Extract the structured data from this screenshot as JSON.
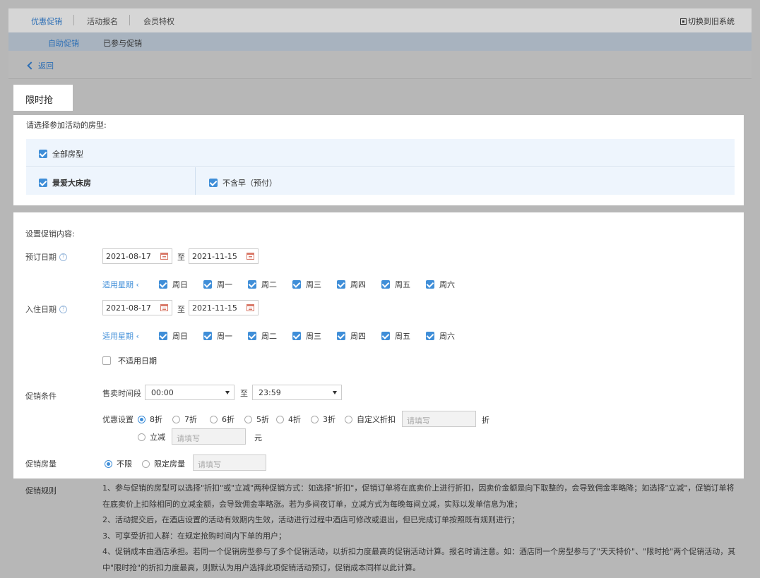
{
  "topnav": {
    "tabs": [
      {
        "label": "优惠促销",
        "active": true
      },
      {
        "label": "活动报名",
        "active": false
      },
      {
        "label": "会员特权",
        "active": false
      }
    ],
    "switch_label": "切换到旧系统"
  },
  "subnav": {
    "tabs": [
      {
        "label": "自助促销",
        "active": true
      },
      {
        "label": "已参与促销",
        "active": false
      }
    ]
  },
  "back_label": "返回",
  "page_title": "限时抢",
  "rooms": {
    "prompt": "请选择参加活动的房型:",
    "all_label": "全部房型",
    "room_name": "景爱大床房",
    "rate_plan": "不含早（预付）"
  },
  "promo": {
    "section_title": "设置促销内容:",
    "booking_date": {
      "label": "预订日期",
      "start": "2021-08-17",
      "separator": "至",
      "end": "2021-11-15",
      "week_link": "适用星期",
      "weekdays": [
        "周日",
        "周一",
        "周二",
        "周三",
        "周四",
        "周五",
        "周六"
      ]
    },
    "checkin_date": {
      "label": "入住日期",
      "start": "2021-08-17",
      "separator": "至",
      "end": "2021-11-15",
      "week_link": "适用星期",
      "weekdays": [
        "周日",
        "周一",
        "周二",
        "周三",
        "周四",
        "周五",
        "周六"
      ],
      "exclude_label": "不适用日期"
    },
    "condition": {
      "label": "促销条件",
      "sale_time_label": "售卖时间段",
      "time_start": "00:00",
      "time_separator": "至",
      "time_end": "23:59",
      "discount_label": "优惠设置",
      "discount_options": [
        "8折",
        "7折",
        "6折",
        "5折",
        "4折",
        "3折",
        "自定义折扣"
      ],
      "selected_discount": "8折",
      "custom_placeholder": "请填写",
      "custom_unit": "折",
      "reduce_label": "立减",
      "reduce_placeholder": "请填写",
      "reduce_unit": "元"
    },
    "rooms_limit": {
      "label": "促销房量",
      "options": [
        "不限",
        "限定房量"
      ],
      "selected": "不限",
      "placeholder": "请填写"
    }
  },
  "rules": {
    "label": "促销规则",
    "lines": [
      "1、参与促销的房型可以选择\"折扣\"或\"立减\"两种促销方式：如选择\"折扣\"，促销订单将在底卖价上进行折扣，因卖价金额是向下取整的，会导致佣金率略降；如选择\"立减\"，促销订单将在底卖价上扣除相同的立减金额，会导致佣金率略涨。若为多间夜订单，立减方式为每晚每间立减，实际以发单信息为准；",
      "2、活动提交后，在酒店设置的活动有效期内生效，活动进行过程中酒店可修改或退出，但已完成订单按照既有规则进行；",
      "3、可享受折扣人群：在规定抢购时间内下单的用户；",
      "4、促销成本由酒店承担。若同一个促销房型参与了多个促销活动，以折扣力度最高的促销活动计算。报名时请注意。如：酒店同一个房型参与了\"天天特价\"、\"限时抢\"两个促销活动，其中\"限时抢\"的折扣力度最高，则默认为用户选择此项促销活动预订，促销成本同样以此计算。"
    ]
  },
  "colors": {
    "accent": "#3f8ed8",
    "overlay": "#b7b7b7",
    "link": "#2e6fb5"
  }
}
